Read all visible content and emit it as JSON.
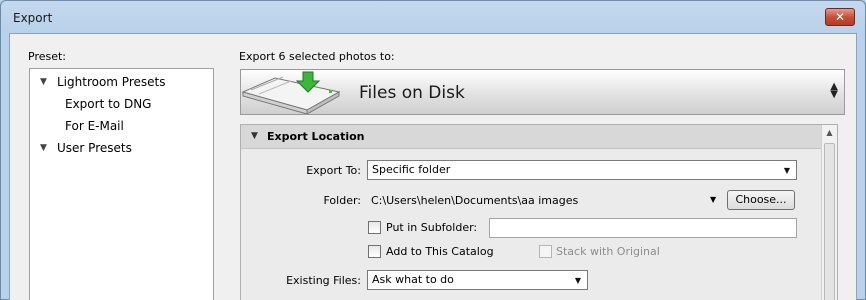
{
  "window": {
    "title": "Export",
    "close_glyph": "✕"
  },
  "preset": {
    "label": "Preset:",
    "items": [
      {
        "label": "Lightroom Presets",
        "expanded": true
      },
      {
        "label": "Export to DNG"
      },
      {
        "label": "For E-Mail"
      },
      {
        "label": "User Presets",
        "expanded": true
      }
    ]
  },
  "export": {
    "heading": "Export 6 selected photos to:",
    "destination": "Files on Disk",
    "destination_icon": "hard-drive-download-icon"
  },
  "section": {
    "title": "Export Location",
    "export_to_label": "Export To:",
    "export_to_value": "Specific folder",
    "folder_label": "Folder:",
    "folder_path": "C:\\Users\\helen\\Documents\\aa images",
    "choose_label": "Choose...",
    "subfolder_label": "Put in Subfolder:",
    "subfolder_value": "",
    "add_catalog_label": "Add to This Catalog",
    "stack_label": "Stack with Original",
    "existing_label": "Existing Files:",
    "existing_value": "Ask what to do"
  },
  "colors": {
    "accent": "#2a9a2a",
    "titlebar": "#c4d9ef",
    "close": "#c7503a"
  }
}
